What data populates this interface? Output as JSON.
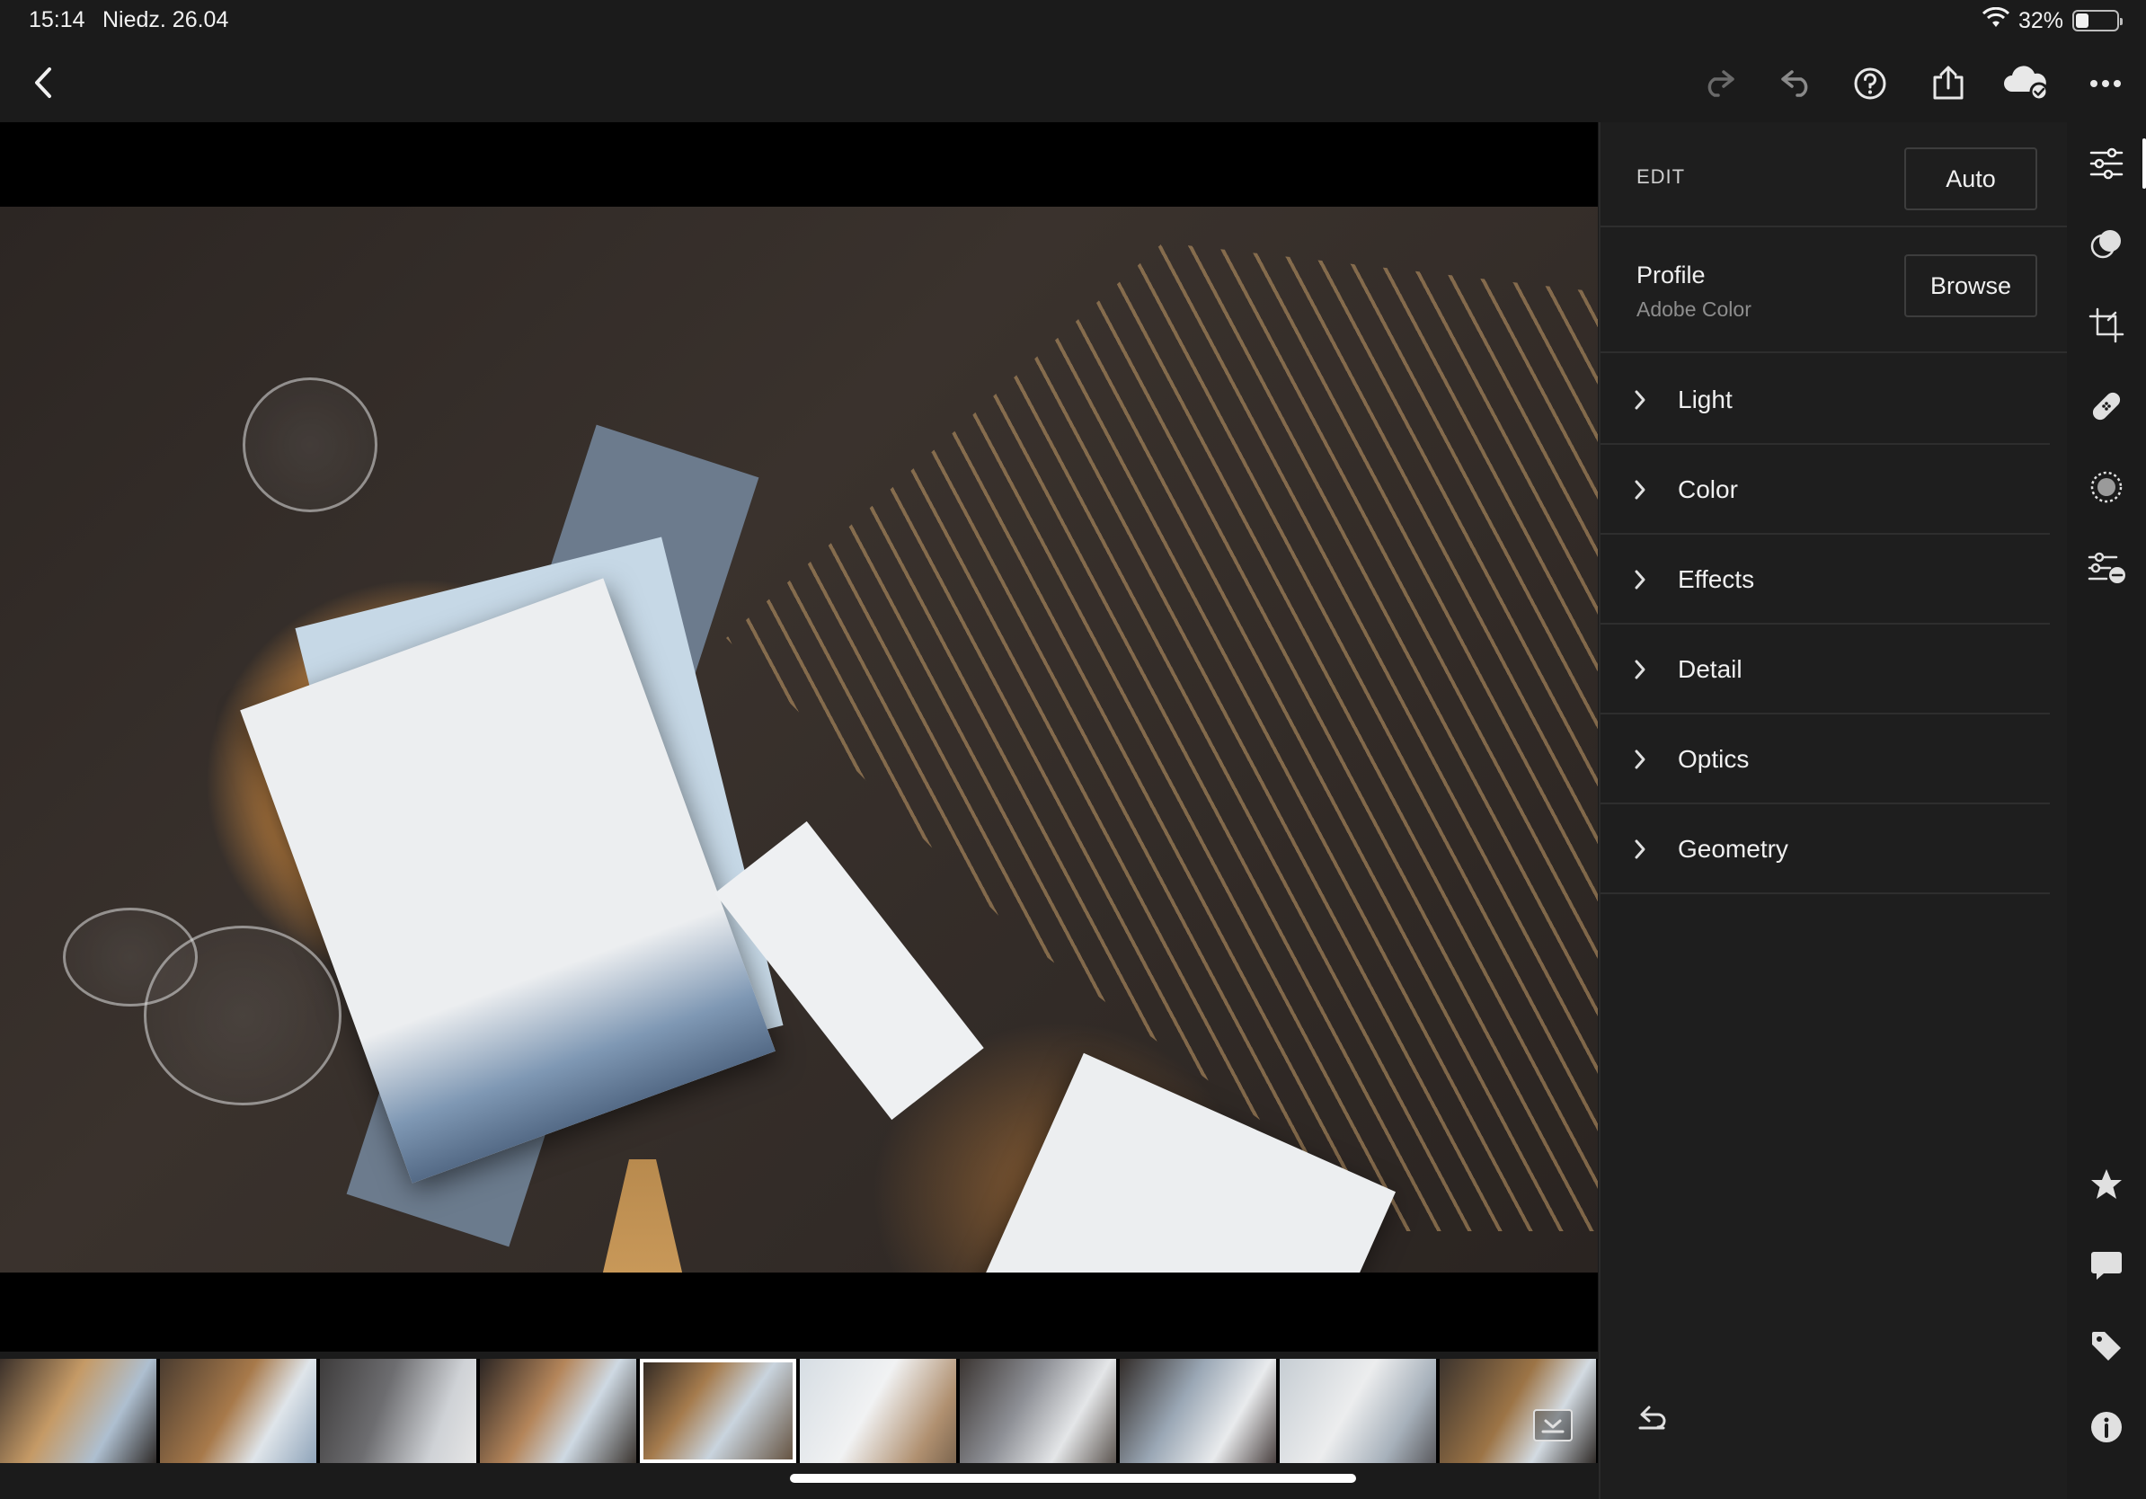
{
  "status_bar": {
    "time": "15:14",
    "date": "Niedz. 26.04",
    "battery": "32%",
    "battery_level": 0.32
  },
  "top_bar": {
    "back_icon": "chevron-left-icon",
    "redo_icon": "redo-icon",
    "undo_icon": "undo-icon",
    "help_icon": "help-icon",
    "share_icon": "share-icon",
    "cloud_icon": "cloud-sync-icon",
    "more_icon": "more-icon"
  },
  "edit_panel": {
    "title": "EDIT",
    "auto_label": "Auto",
    "profile": {
      "title": "Profile",
      "value": "Adobe Color",
      "browse_label": "Browse"
    },
    "sections": [
      {
        "label": "Light"
      },
      {
        "label": "Color"
      },
      {
        "label": "Effects"
      },
      {
        "label": "Detail"
      },
      {
        "label": "Optics"
      },
      {
        "label": "Geometry"
      }
    ]
  },
  "filmstrip": {
    "thumb_count": 10,
    "active_index": 4
  },
  "colors": {
    "background": "#1b1b1b",
    "panel": "#1e1e1e",
    "divider": "#2e2e2e",
    "text": "#f0f0f0",
    "muted": "#8d8d8d"
  }
}
